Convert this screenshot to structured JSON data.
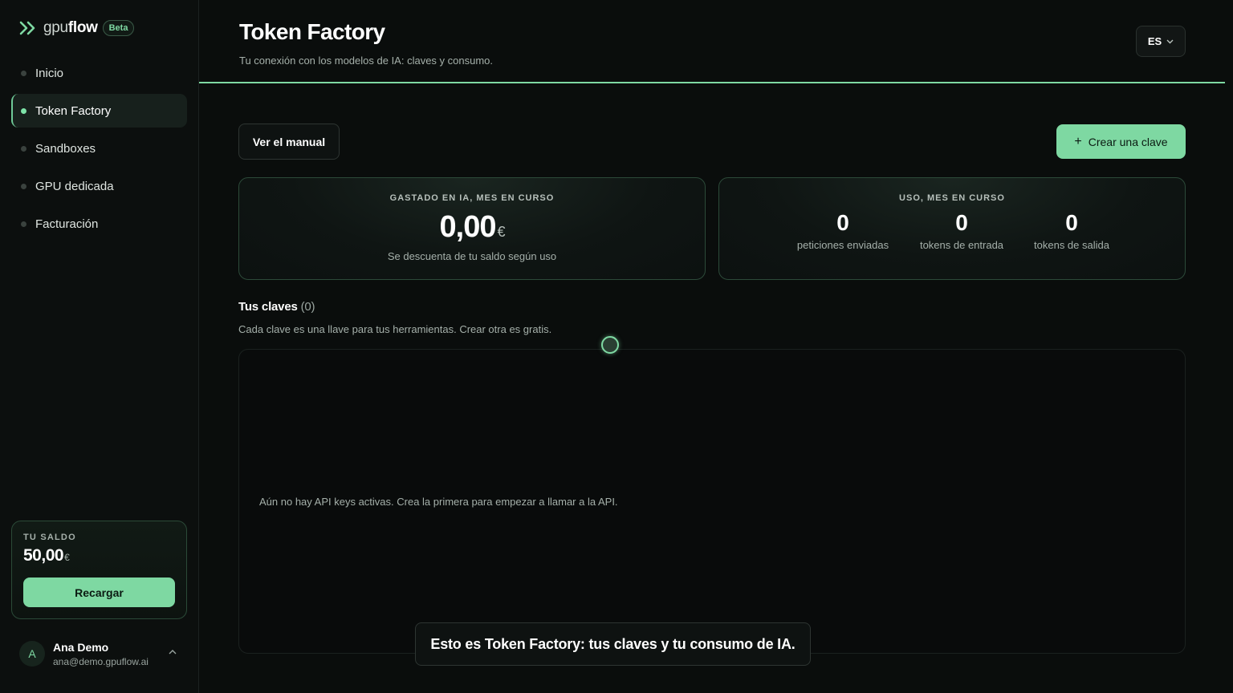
{
  "brand": {
    "name_light": "gpu",
    "name_bold": "flow",
    "badge": "Beta"
  },
  "sidebar": {
    "items": [
      {
        "label": "Inicio",
        "active": false
      },
      {
        "label": "Token Factory",
        "active": true
      },
      {
        "label": "Sandboxes",
        "active": false
      },
      {
        "label": "GPU dedicada",
        "active": false
      },
      {
        "label": "Facturación",
        "active": false
      }
    ],
    "balance": {
      "label": "TU SALDO",
      "amount": "50,00",
      "currency": "€",
      "button": "Recargar"
    },
    "user": {
      "initial": "A",
      "name": "Ana Demo",
      "email": "ana@demo.gpuflow.ai",
      "chevron": "^"
    }
  },
  "header": {
    "title": "Token Factory",
    "subtitle": "Tu conexión con los modelos de IA: claves y consumo.",
    "language": "ES"
  },
  "actions": {
    "manual": "Ver el manual",
    "create_icon": "+",
    "create": "Crear una clave"
  },
  "spent_card": {
    "label": "GASTADO EN IA, MES EN CURSO",
    "amount": "0,00",
    "currency": "€",
    "note": "Se descuenta de tu saldo según uso"
  },
  "usage_card": {
    "label": "USO, MES EN CURSO",
    "metrics": [
      {
        "value": "0",
        "label": "peticiones enviadas"
      },
      {
        "value": "0",
        "label": "tokens de entrada"
      },
      {
        "value": "0",
        "label": "tokens de salida"
      }
    ]
  },
  "keys": {
    "title": "Tus claves",
    "count": "(0)",
    "subtitle": "Cada clave es una llave para tus herramientas. Crear otra es gratis.",
    "empty": "Aún no hay API keys activas. Crea la primera para empezar a llamar a la API."
  },
  "toast": "Esto es Token Factory: tus claves y tu consumo de IA.",
  "colors": {
    "accent": "#7ed8a2",
    "background": "#0a0d0c",
    "card_border": "#2c4a39"
  },
  "icons": {
    "logo": "double-chevron-right-icon",
    "language_chevron": "chevron-down-icon",
    "user_chevron": "chevron-up-icon",
    "create": "plus-icon"
  }
}
